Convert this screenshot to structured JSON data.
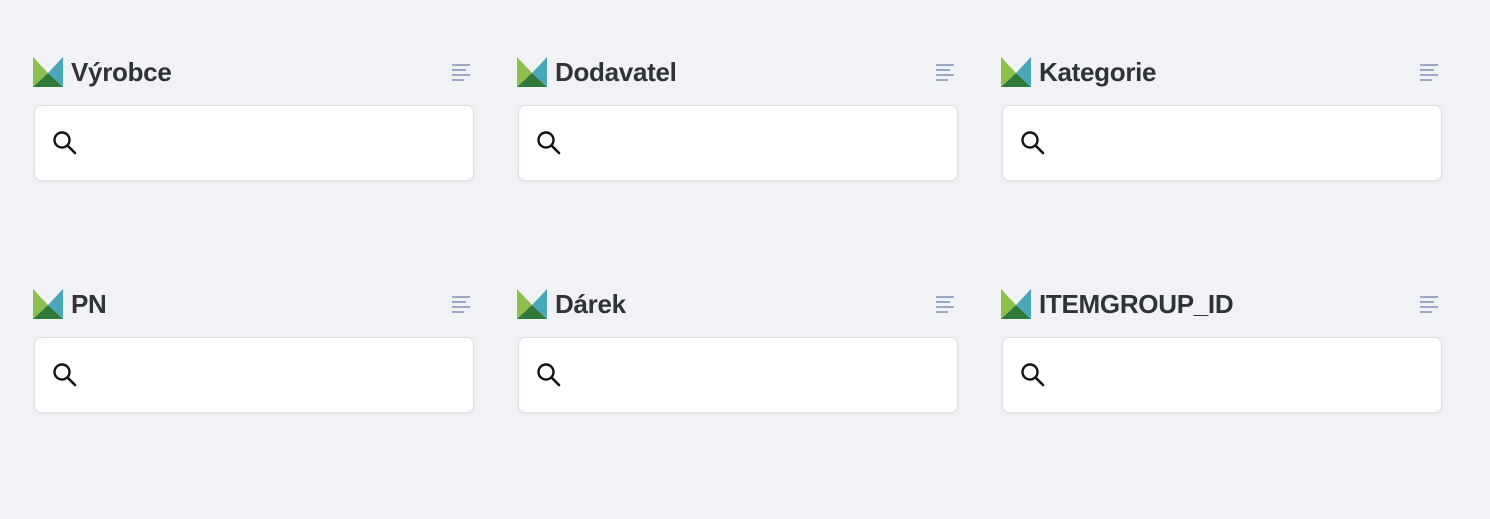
{
  "filters": [
    {
      "title": "Výrobce",
      "search_value": "",
      "search_placeholder": ""
    },
    {
      "title": "Dodavatel",
      "search_value": "",
      "search_placeholder": ""
    },
    {
      "title": "Kategorie",
      "search_value": "",
      "search_placeholder": ""
    },
    {
      "title": "PN",
      "search_value": "",
      "search_placeholder": ""
    },
    {
      "title": "Dárek",
      "search_value": "",
      "search_placeholder": ""
    },
    {
      "title": "ITEMGROUP_ID",
      "search_value": "",
      "search_placeholder": ""
    }
  ],
  "icons": {
    "filter_logo": "filter-logo-icon",
    "sort": "sort-lines-icon",
    "search": "search-icon"
  },
  "colors": {
    "background": "#f1f2f5",
    "title_text": "#303335",
    "logo_light_green": "#8cc04a",
    "logo_dark_green": "#2f7a3a",
    "logo_teal": "#4aa7b9",
    "sort_icon": "#9aa9c7"
  }
}
